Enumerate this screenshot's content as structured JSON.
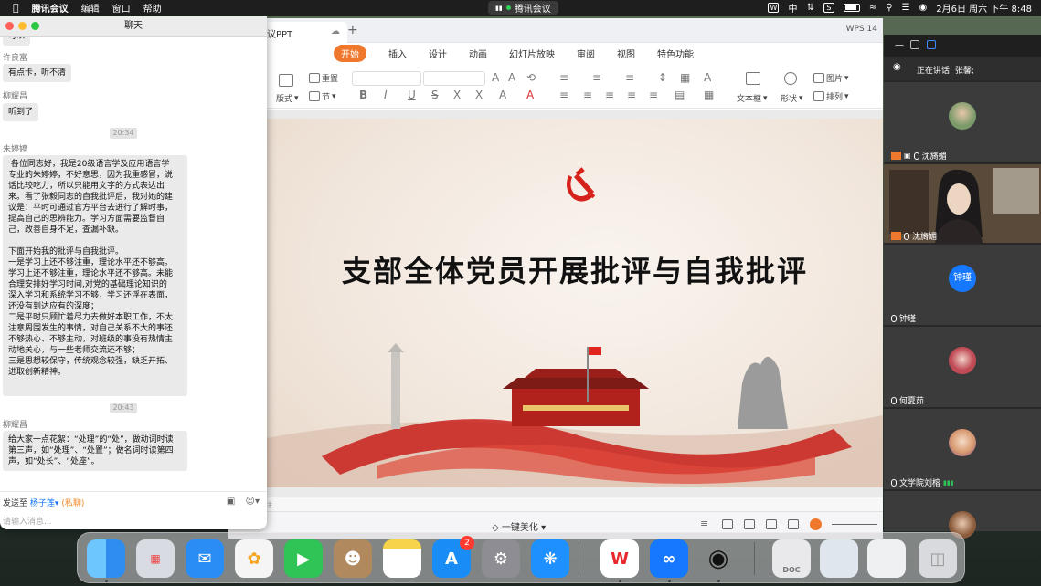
{
  "menubar": {
    "apple": "",
    "items": [
      "腾讯会议",
      "编辑",
      "窗口",
      "帮助"
    ],
    "center_label": "腾讯会议",
    "input_method": "中",
    "datetime": "2月6日 周六 下午 8:48"
  },
  "chat": {
    "title": "聊天",
    "messages": [
      {
        "type": "bubble",
        "text": "可以"
      },
      {
        "type": "name",
        "text": "许良富"
      },
      {
        "type": "bubble",
        "text": "有点卡，听不清"
      },
      {
        "type": "name",
        "text": "柳耀昌"
      },
      {
        "type": "bubble",
        "text": "听到了"
      },
      {
        "type": "time",
        "text": "20:34"
      },
      {
        "type": "name",
        "text": "朱婷婷"
      },
      {
        "type": "bubble",
        "text": " 各位同志好，我是20级语言学及应用语言学\n专业的朱婷婷，不好意思，因为我重感冒，说\n话比较吃力，所以只能用文字的方式表达出\n来。看了张毅同志的自我批评后，我对她的建\n议是：平时可通过官方平台去进行了解时事，\n提高自己的思辨能力。学习方面需要监督自\n己，改善自身不足，查漏补缺。\n\n下面开始我的批评与自我批评。\n一是学习上还不够注重，理论水平还不够高。\n学习上还不够注重，理论水平还不够高。未能\n合理安排好学习时间,对党的基础理论知识的\n深入学习和系统学习不够，学习还浮在表面，\n还没有到达应有的深度；\n二是平时只顾忙着尽力去做好本职工作，不太\n注意周围发生的事情，对自己关系不大的事还\n不够热心、不够主动，对班级的事没有热情主\n动地关心，与一些老师交流还不够；\n三是思想较保守，传统观念较强，缺乏开拓、\n进取创新精神。"
      },
      {
        "type": "time",
        "text": "20:43"
      },
      {
        "type": "name",
        "text": "柳耀昌"
      },
      {
        "type": "bubble",
        "text": "给大家一点花絮：“处理”的“处”，做动词时读\n第三声，如“处理”、“处置”；做名词时读第四\n声，如“处长”、“处座”。"
      }
    ],
    "send_to_label": "发送至",
    "send_to_target": "杨子莲",
    "send_to_private": "(私聊)",
    "input_placeholder": "请输入消息..."
  },
  "ppt": {
    "tab_title": "议PPT",
    "ribbon_tabs": [
      "开始",
      "插入",
      "设计",
      "动画",
      "幻灯片放映",
      "审阅",
      "视图",
      "特色功能"
    ],
    "tools": {
      "reset": "重置",
      "layout": "版式",
      "section": "节",
      "textbox": "文本框",
      "shape": "形状",
      "picture": "图片",
      "arrange": "排列"
    },
    "slide_title": "支部全体党员开展批评与自我批评",
    "notes_placeholder": "注",
    "beautify": "一键美化",
    "wps_label": "WPS 14"
  },
  "meeting": {
    "speaking": "正在讲话: 张馨;",
    "participants": [
      {
        "name": "沈旖媚",
        "kind": "avatar",
        "color": "#7a9a6a"
      },
      {
        "name": "沈旖媚",
        "kind": "video"
      },
      {
        "name": "钟瑾",
        "kind": "text-avatar",
        "avatar_text": "钟瑾"
      },
      {
        "name": "何夏茹",
        "kind": "avatar",
        "color": "#c04a55"
      },
      {
        "name": "文学院刘榕",
        "kind": "avatar",
        "color": "#d89a70"
      },
      {
        "name": "",
        "kind": "avatar",
        "color": "#8a5a3a"
      }
    ]
  },
  "dock": {
    "apps": [
      {
        "name": "finder",
        "label": "",
        "color": "#2f8cf0"
      },
      {
        "name": "launchpad",
        "label": "",
        "color": "#d8dbe2"
      },
      {
        "name": "mail",
        "label": "",
        "color": "#2a8cf5"
      },
      {
        "name": "photos",
        "label": "",
        "color": "#f5f5f5"
      },
      {
        "name": "facetime",
        "label": "",
        "color": "#2fc455"
      },
      {
        "name": "contacts",
        "label": "",
        "color": "#b08a5e"
      },
      {
        "name": "notes",
        "label": "",
        "color": "#f7d34b"
      },
      {
        "name": "app-store",
        "label": "",
        "color": "#1a8cf6",
        "badge": "2"
      },
      {
        "name": "system-preferences",
        "label": "",
        "color": "#8d8d93"
      },
      {
        "name": "safari",
        "label": "",
        "color": "#1e90ff"
      },
      {
        "name": "wps",
        "label": "W",
        "color": "#ffffff"
      },
      {
        "name": "tencent-meeting",
        "label": "",
        "color": "#1677ff"
      },
      {
        "name": "qq",
        "label": "",
        "color": "#ffffff"
      },
      {
        "name": "doc-file",
        "label": "DOC",
        "color": "#e9e9ec"
      },
      {
        "name": "screenshot-1",
        "label": "",
        "color": "#dfe6ee"
      },
      {
        "name": "screenshot-2",
        "label": "",
        "color": "#eef0f2"
      },
      {
        "name": "trash",
        "label": "",
        "color": "#d9dadd"
      }
    ]
  }
}
